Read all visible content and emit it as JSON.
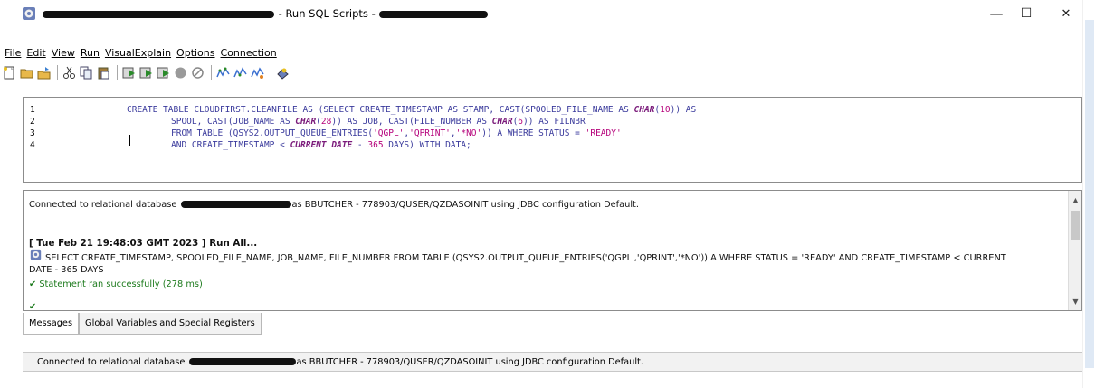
{
  "window": {
    "title_suffix": "- Run SQL Scripts -",
    "minimize": "—",
    "maximize": "☐",
    "close": "✕"
  },
  "menu": [
    {
      "label": "File"
    },
    {
      "label": "Edit"
    },
    {
      "label": "View"
    },
    {
      "label": "Run"
    },
    {
      "label": "VisualExplain"
    },
    {
      "label": "Options"
    },
    {
      "label": "Connection"
    }
  ],
  "editor": {
    "line_numbers": [
      "1",
      "2",
      "3",
      "4"
    ]
  },
  "messages": {
    "connected_prefix": "Connected to relational database",
    "connected_suffix": "as BBUTCHER - 778903/QUSER/QZDASOINIT using JDBC configuration Default.",
    "run_header": "[ Tue Feb 21 19:48:03 GMT 2023 ]  Run All...",
    "statement_line1": "SELECT CREATE_TIMESTAMP, SPOOLED_FILE_NAME, JOB_NAME, FILE_NUMBER FROM TABLE (QSYS2.OUTPUT_QUEUE_ENTRIES('QGPL','QPRINT','*NO')) A WHERE STATUS = 'READY' AND CREATE_TIMESTAMP < CURRENT",
    "statement_line2": "DATE - 365 DAYS",
    "success": "Statement ran successfully",
    "success_time": "(278 ms)"
  },
  "tabs": [
    {
      "label": "Messages"
    },
    {
      "label": "Global Variables and Special Registers"
    }
  ],
  "status": {
    "prefix": "Connected to relational database",
    "suffix": "as BBUTCHER - 778903/QUSER/QZDASOINIT using JDBC configuration Default."
  },
  "colors": {
    "keyword": "#4b3ba0",
    "string": "#b5007a",
    "success_green": "#1c7a1c"
  }
}
